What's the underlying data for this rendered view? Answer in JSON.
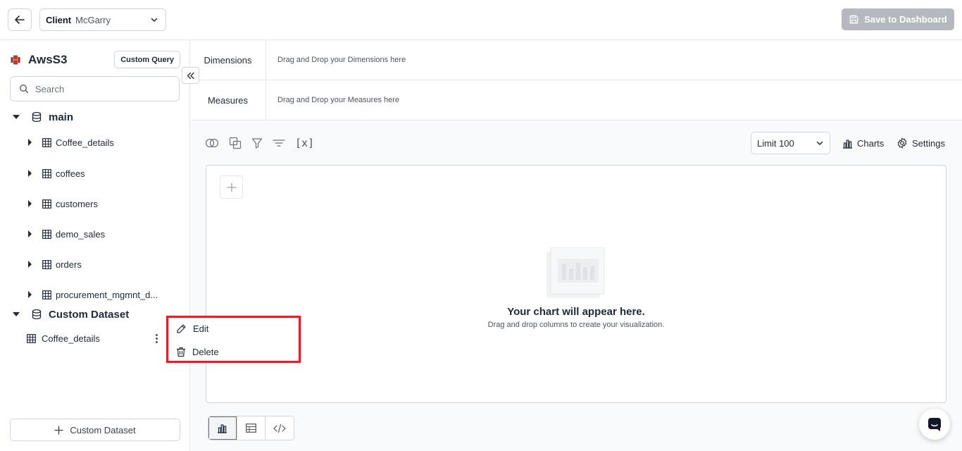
{
  "topbar": {
    "client_label": "Client",
    "client_value": "McGarry",
    "save_label": "Save to Dashboard"
  },
  "sidebar": {
    "source_name": "AwsS3",
    "custom_query_label": "Custom Query",
    "search_placeholder": "Search",
    "databases": [
      {
        "name": "main",
        "expanded": true,
        "tables": [
          "Coffee_details",
          "coffees",
          "customers",
          "demo_sales",
          "orders",
          "procurement_mgmnt_d..."
        ]
      },
      {
        "name": "Custom Dataset",
        "expanded": true,
        "items": [
          "Coffee_details"
        ]
      }
    ],
    "add_dataset_label": "Custom Dataset"
  },
  "context_menu": {
    "items": [
      "Edit",
      "Delete"
    ],
    "highlight_color": "#e0202a"
  },
  "shelves": {
    "dimensions_title": "Dimensions",
    "dimensions_placeholder": "Drag and Drop your Dimensions here",
    "measures_title": "Measures",
    "measures_placeholder": "Drag and Drop your Measures here"
  },
  "toolbar": {
    "limit_label": "Limit",
    "limit_value": "100",
    "charts_label": "Charts",
    "settings_label": "Settings",
    "variables_symbol": "[x]"
  },
  "canvas": {
    "empty_title": "Your chart will appear here.",
    "empty_subtitle": "Drag and drop columns to create your visualization."
  },
  "colors": {
    "save_button_bg": "#b5b9bf",
    "source_icon": "#c0392b"
  }
}
